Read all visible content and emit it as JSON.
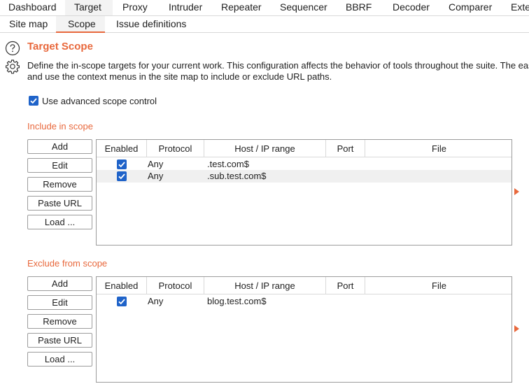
{
  "top_tabs": [
    "Dashboard",
    "Target",
    "Proxy",
    "Intruder",
    "Repeater",
    "Sequencer",
    "BBRF",
    "Decoder",
    "Comparer",
    "Exte"
  ],
  "sub_tabs": [
    "Site map",
    "Scope",
    "Issue definitions"
  ],
  "page": {
    "title": "Target Scope",
    "desc_line1": "Define the in-scope targets for your current work. This configuration affects the behavior of tools throughout the suite. The eas",
    "desc_line2": "and use the context menus in the site map to include or exclude URL paths.",
    "advanced_scope_label": "Use advanced scope control"
  },
  "buttons": {
    "add": "Add",
    "edit": "Edit",
    "remove": "Remove",
    "paste_url": "Paste URL",
    "load": "Load ..."
  },
  "columns": [
    "Enabled",
    "Protocol",
    "Host / IP range",
    "Port",
    "File"
  ],
  "include": {
    "title": "Include in scope",
    "rows": [
      {
        "protocol": "Any",
        "host": ".test.com$",
        "port": "",
        "file": ""
      },
      {
        "protocol": "Any",
        "host": ".sub.test.com$",
        "port": "",
        "file": ""
      }
    ]
  },
  "exclude": {
    "title": "Exclude from scope",
    "rows": [
      {
        "protocol": "Any",
        "host": "blog.test.com$",
        "port": "",
        "file": ""
      }
    ]
  },
  "colors": {
    "accent": "#e8683c",
    "checkbox": "#1f63c9"
  }
}
